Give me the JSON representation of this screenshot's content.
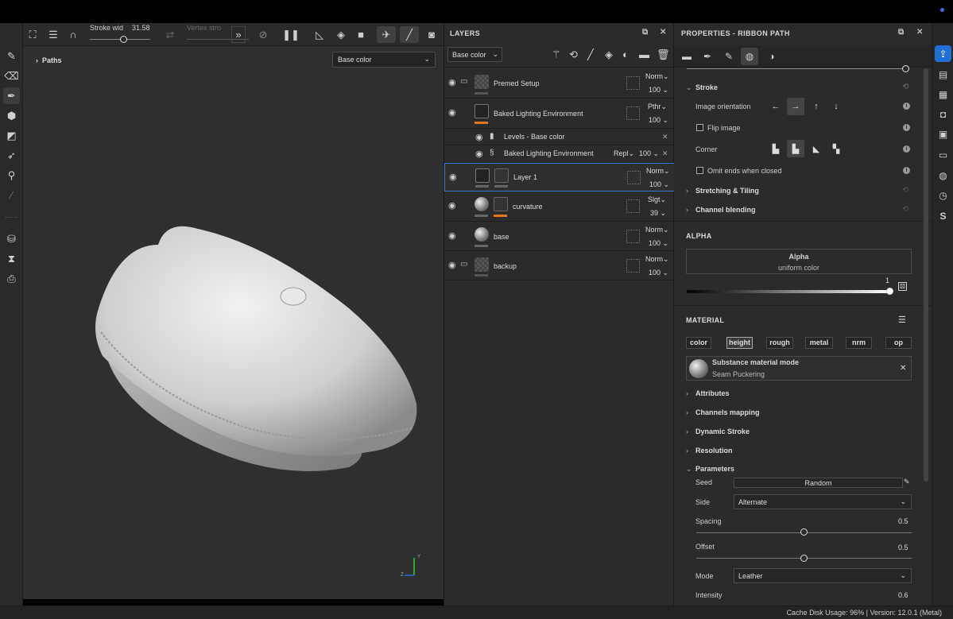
{
  "toolbar": {
    "stroke_label": "Stroke wid",
    "stroke_value": "31.58",
    "vertex_label": "Vertex stro"
  },
  "viewport": {
    "paths_label": "Paths",
    "channel_select": "Base color",
    "axis_y": "Y",
    "axis_z": "Z"
  },
  "layers": {
    "title": "LAYERS",
    "channel_select": "Base color",
    "rows": [
      {
        "name": "Premed Setup",
        "blend": "Norm",
        "opacity": "100"
      },
      {
        "name": "Baked Lighting Environment",
        "blend": "Pthr",
        "opacity": "100"
      },
      {
        "name": "Levels - Base color"
      },
      {
        "name": "Baked Lighting Environment",
        "blend": "Repl",
        "opacity": "100"
      },
      {
        "name": "Layer 1",
        "blend": "Norm",
        "opacity": "100"
      },
      {
        "name": "curvature",
        "blend": "Slgt",
        "opacity": "39"
      },
      {
        "name": "base",
        "blend": "Norm",
        "opacity": "100"
      },
      {
        "name": "backup",
        "blend": "Norm",
        "opacity": "100"
      }
    ]
  },
  "properties": {
    "title": "PROPERTIES - RIBBON PATH",
    "stroke": {
      "title": "Stroke",
      "image_orientation": "Image orientation",
      "flip_image": "Flip image",
      "corner": "Corner",
      "omit_ends": "Omit ends when closed"
    },
    "stretching": "Stretching & Tiling",
    "channel_blending": "Channel blending",
    "alpha": {
      "header": "ALPHA",
      "title": "Alpha",
      "subtitle": "uniform color",
      "value": "1"
    },
    "material": {
      "header": "MATERIAL",
      "channels": [
        "color",
        "height",
        "rough",
        "metal",
        "nrm",
        "op"
      ],
      "card_title": "Substance material mode",
      "card_sub": "Seam Puckering"
    },
    "sections": [
      "Attributes",
      "Channels mapping",
      "Dynamic Stroke",
      "Resolution"
    ],
    "parameters": {
      "title": "Parameters",
      "seed_label": "Seed",
      "seed_value": "Random",
      "side_label": "Side",
      "side_value": "Alternate",
      "spacing_label": "Spacing",
      "spacing_value": "0.5",
      "offset_label": "Offset",
      "offset_value": "0.5",
      "mode_label": "Mode",
      "mode_value": "Leather",
      "intensity_label": "Intensity",
      "intensity_value": "0.6"
    }
  },
  "status": {
    "text": "Cache Disk Usage:    96% | Version: 12.0.1 (Metal)"
  },
  "colors": {
    "accent": "#3a79d6",
    "orange": "#e07a1f",
    "active_blue": "#1f6fd6"
  }
}
